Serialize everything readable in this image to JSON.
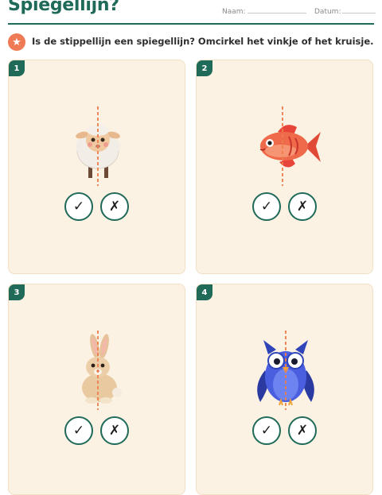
{
  "header": {
    "title": "Spiegellijn?",
    "name_label": "Naam:",
    "date_label": "Datum:"
  },
  "instruction": {
    "icon": "star-icon",
    "text": "Is de stippellijn een spiegellijn? Omcirkel het vinkje of het kruisje."
  },
  "colors": {
    "brand": "#1f6a58",
    "accent": "#ef7a56",
    "card_bg": "#fcf2e3",
    "mirror_line": "#ee7d4a"
  },
  "items": [
    {
      "number": "1",
      "animal": "sheep",
      "check": "✓",
      "cross": "✗"
    },
    {
      "number": "2",
      "animal": "fish",
      "check": "✓",
      "cross": "✗"
    },
    {
      "number": "3",
      "animal": "rabbit",
      "check": "✓",
      "cross": "✗"
    },
    {
      "number": "4",
      "animal": "owl",
      "check": "✓",
      "cross": "✗"
    }
  ]
}
